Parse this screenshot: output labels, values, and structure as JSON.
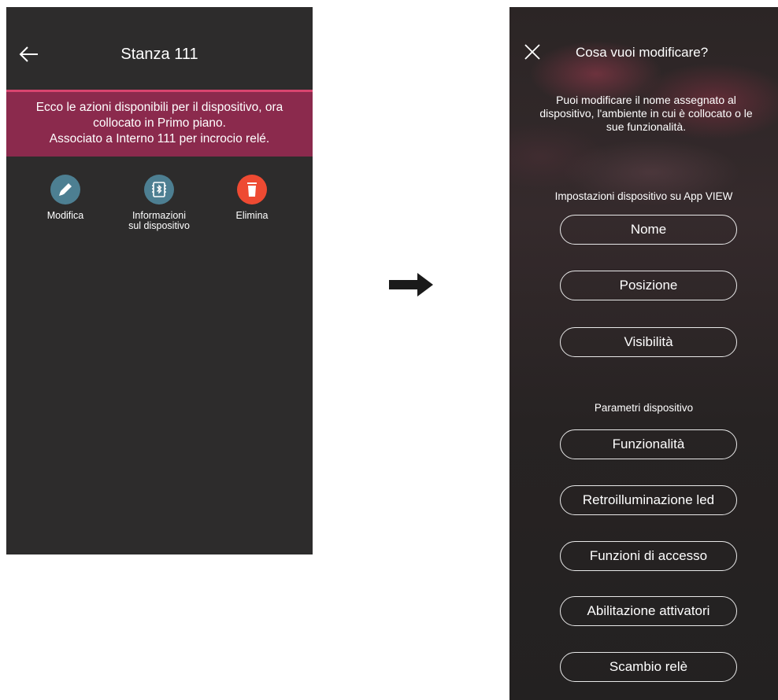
{
  "left_screen": {
    "title": "Stanza 111",
    "banner_lines": [
      "Ecco le azioni disponibili per il dispositivo, ora",
      "collocato in Primo piano.",
      "Associato a Interno 111 per incrocio relé."
    ],
    "actions": [
      {
        "label_line1": "Modifica",
        "label_line2": "",
        "icon": "pencil-icon",
        "color": "#4d7f92"
      },
      {
        "label_line1": "Informazioni",
        "label_line2": "sul dispositivo",
        "icon": "bluetooth-chip-icon",
        "color": "#4d7f92"
      },
      {
        "label_line1": "Elimina",
        "label_line2": "",
        "icon": "trash-icon",
        "color": "#ee4a32"
      }
    ]
  },
  "right_screen": {
    "title": "Cosa vuoi modificare?",
    "description_lines": [
      "Puoi modificare il nome assegnato al",
      "dispositivo, l'ambiente in cui è collocato o le",
      "sue funzionalità."
    ],
    "section_app": "Impostazioni dispositivo su App VIEW",
    "app_buttons": [
      "Nome",
      "Posizione",
      "Visibilità"
    ],
    "section_device": "Parametri dispositivo",
    "device_buttons": [
      "Funzionalità",
      "Retroilluminazione led",
      "Funzioni di accesso",
      "Abilitazione attivatori",
      "Scambio relè"
    ]
  },
  "colors": {
    "screen_bg": "#2d2c2c",
    "banner_bg": "#8b2a4d",
    "banner_accent": "#d8456f"
  }
}
